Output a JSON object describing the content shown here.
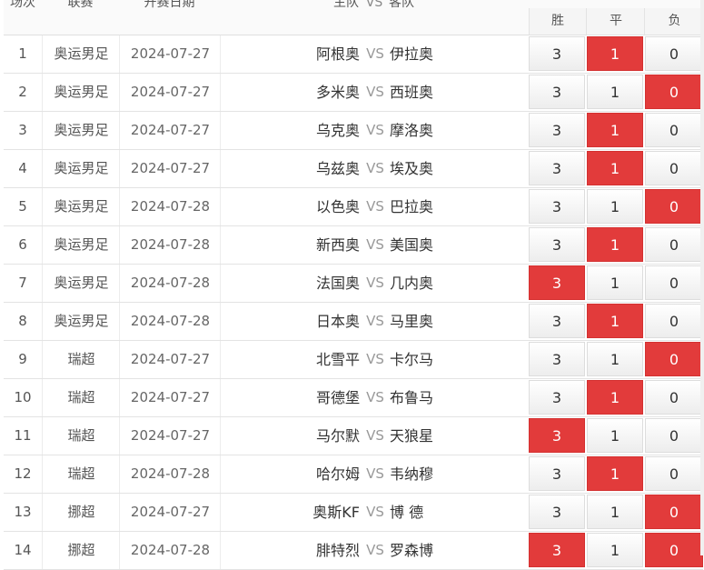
{
  "header": {
    "col_index": "场次",
    "col_league": "联赛",
    "col_date": "开赛日期",
    "col_home": "主队",
    "col_vs": "VS",
    "col_away": "客队",
    "col_win": "胜",
    "col_draw": "平",
    "col_loss": "负"
  },
  "vs_text": "VS",
  "colors": {
    "selected": "#e23b3b"
  },
  "matches": [
    {
      "no": "1",
      "league": "奥运男足",
      "date": "2024-07-27",
      "home": "阿根奥",
      "away": "伊拉奥",
      "w": "3",
      "d": "1",
      "l": "0",
      "selected": "d"
    },
    {
      "no": "2",
      "league": "奥运男足",
      "date": "2024-07-27",
      "home": "多米奥",
      "away": "西班奥",
      "w": "3",
      "d": "1",
      "l": "0",
      "selected": "l"
    },
    {
      "no": "3",
      "league": "奥运男足",
      "date": "2024-07-27",
      "home": "乌克奥",
      "away": "摩洛奥",
      "w": "3",
      "d": "1",
      "l": "0",
      "selected": "d"
    },
    {
      "no": "4",
      "league": "奥运男足",
      "date": "2024-07-27",
      "home": "乌兹奥",
      "away": "埃及奥",
      "w": "3",
      "d": "1",
      "l": "0",
      "selected": "d"
    },
    {
      "no": "5",
      "league": "奥运男足",
      "date": "2024-07-28",
      "home": "以色奥",
      "away": "巴拉奥",
      "w": "3",
      "d": "1",
      "l": "0",
      "selected": "l"
    },
    {
      "no": "6",
      "league": "奥运男足",
      "date": "2024-07-28",
      "home": "新西奥",
      "away": "美国奥",
      "w": "3",
      "d": "1",
      "l": "0",
      "selected": "d"
    },
    {
      "no": "7",
      "league": "奥运男足",
      "date": "2024-07-28",
      "home": "法国奥",
      "away": "几内奥",
      "w": "3",
      "d": "1",
      "l": "0",
      "selected": "w"
    },
    {
      "no": "8",
      "league": "奥运男足",
      "date": "2024-07-28",
      "home": "日本奥",
      "away": "马里奥",
      "w": "3",
      "d": "1",
      "l": "0",
      "selected": "d"
    },
    {
      "no": "9",
      "league": "瑞超",
      "date": "2024-07-27",
      "home": "北雪平",
      "away": "卡尔马",
      "w": "3",
      "d": "1",
      "l": "0",
      "selected": "l"
    },
    {
      "no": "10",
      "league": "瑞超",
      "date": "2024-07-27",
      "home": "哥德堡",
      "away": "布鲁马",
      "w": "3",
      "d": "1",
      "l": "0",
      "selected": "d"
    },
    {
      "no": "11",
      "league": "瑞超",
      "date": "2024-07-27",
      "home": "马尔默",
      "away": "天狼星",
      "w": "3",
      "d": "1",
      "l": "0",
      "selected": "w"
    },
    {
      "no": "12",
      "league": "瑞超",
      "date": "2024-07-28",
      "home": "哈尔姆",
      "away": "韦纳穆",
      "w": "3",
      "d": "1",
      "l": "0",
      "selected": "d"
    },
    {
      "no": "13",
      "league": "挪超",
      "date": "2024-07-27",
      "home": "奥斯KF",
      "away": "博 德",
      "w": "3",
      "d": "1",
      "l": "0",
      "selected": "l"
    },
    {
      "no": "14",
      "league": "挪超",
      "date": "2024-07-28",
      "home": "腓特烈",
      "away": "罗森博",
      "w": "3",
      "d": "1",
      "l": "0",
      "selected": "wl"
    }
  ]
}
